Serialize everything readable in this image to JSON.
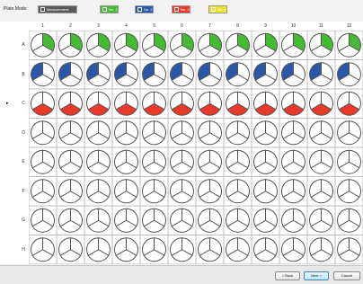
{
  "toolbar": {
    "title": "Plate Mode:",
    "buttons": [
      {
        "label": "Measurement",
        "color": "#5a5a5a"
      },
      {
        "label": "No. 1",
        "color": "#44bb33"
      },
      {
        "label": "No. 2",
        "color": "#2b57a8"
      },
      {
        "label": "No. 3",
        "color": "#e8392a"
      },
      {
        "label": "No. 4",
        "color": "#e8e32a"
      }
    ]
  },
  "plate": {
    "columns": [
      "1",
      "2",
      "3",
      "4",
      "5",
      "6",
      "7",
      "8",
      "9",
      "10",
      "11",
      "12"
    ],
    "rows": [
      "A",
      "B",
      "C",
      "D",
      "E",
      "F",
      "G",
      "H"
    ],
    "current_row": "C",
    "current_row_marker": "▸",
    "row_fill": {
      "A": {
        "segment": "top-right",
        "color": "#44bb33"
      },
      "B": {
        "segment": "left",
        "color": "#2b57a8"
      },
      "C": {
        "segment": "bottom",
        "color": "#e8392a"
      }
    }
  },
  "footer": {
    "back_label": "< Back",
    "next_label": "Next >",
    "cancel_label": "Cancel"
  },
  "colors": {
    "well_stroke": "#555555",
    "grid_line": "#bdbdbd"
  }
}
